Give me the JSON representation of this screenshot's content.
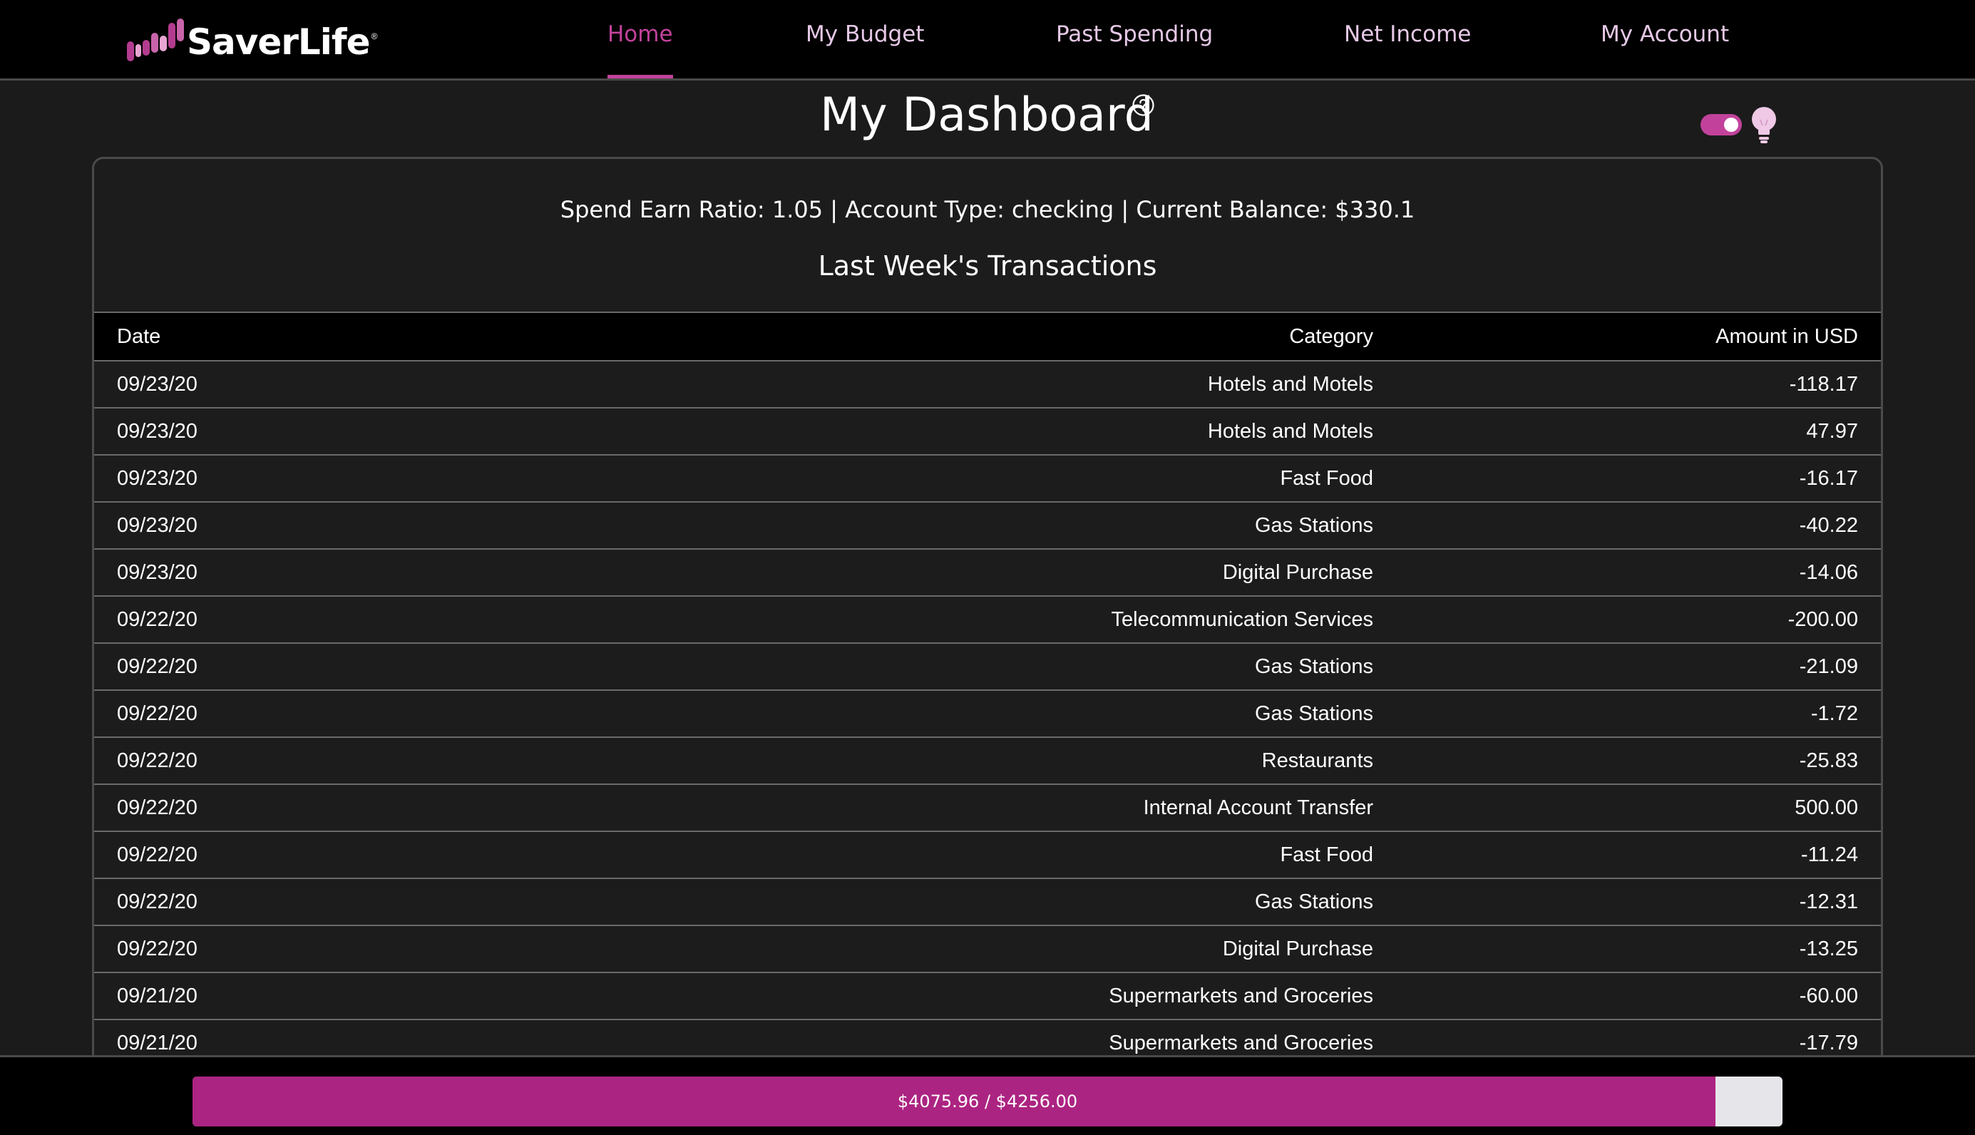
{
  "brand": {
    "name": "SaverLife",
    "registered_mark": "®",
    "accent_color": "#c2429b",
    "logo_bar_color": "#b43c90"
  },
  "nav": {
    "items": [
      {
        "label": "Home",
        "active": true
      },
      {
        "label": "My Budget",
        "active": false
      },
      {
        "label": "Past Spending",
        "active": false
      },
      {
        "label": "Net Income",
        "active": false
      },
      {
        "label": "My Account",
        "active": false
      }
    ]
  },
  "dashboard": {
    "title": "My Dashboard",
    "help_icon": "question-circle-icon",
    "theme_toggle_on": true,
    "theme_icon": "lightbulb-icon"
  },
  "summary": {
    "text": "Spend Earn Ratio: 1.05 | Account Type: checking | Current Balance: $330.1"
  },
  "transactions": {
    "title": "Last Week's Transactions",
    "columns": {
      "date": "Date",
      "category": "Category",
      "amount": "Amount in USD"
    },
    "rows": [
      {
        "date": "09/23/20",
        "category": "Hotels and Motels",
        "amount": "-118.17"
      },
      {
        "date": "09/23/20",
        "category": "Hotels and Motels",
        "amount": "47.97"
      },
      {
        "date": "09/23/20",
        "category": "Fast Food",
        "amount": "-16.17"
      },
      {
        "date": "09/23/20",
        "category": "Gas Stations",
        "amount": "-40.22"
      },
      {
        "date": "09/23/20",
        "category": "Digital Purchase",
        "amount": "-14.06"
      },
      {
        "date": "09/22/20",
        "category": "Telecommunication Services",
        "amount": "-200.00"
      },
      {
        "date": "09/22/20",
        "category": "Gas Stations",
        "amount": "-21.09"
      },
      {
        "date": "09/22/20",
        "category": "Gas Stations",
        "amount": "-1.72"
      },
      {
        "date": "09/22/20",
        "category": "Restaurants",
        "amount": "-25.83"
      },
      {
        "date": "09/22/20",
        "category": "Internal Account Transfer",
        "amount": "500.00"
      },
      {
        "date": "09/22/20",
        "category": "Fast Food",
        "amount": "-11.24"
      },
      {
        "date": "09/22/20",
        "category": "Gas Stations",
        "amount": "-12.31"
      },
      {
        "date": "09/22/20",
        "category": "Digital Purchase",
        "amount": "-13.25"
      },
      {
        "date": "09/21/20",
        "category": "Supermarkets and Groceries",
        "amount": "-60.00"
      },
      {
        "date": "09/21/20",
        "category": "Supermarkets and Groceries",
        "amount": "-17.79"
      }
    ]
  },
  "budget_progress": {
    "label": "$4075.96 / $4256.00",
    "fraction": 0.9577,
    "fill_color": "#ac2482",
    "track_color": "#e6e6ea"
  }
}
